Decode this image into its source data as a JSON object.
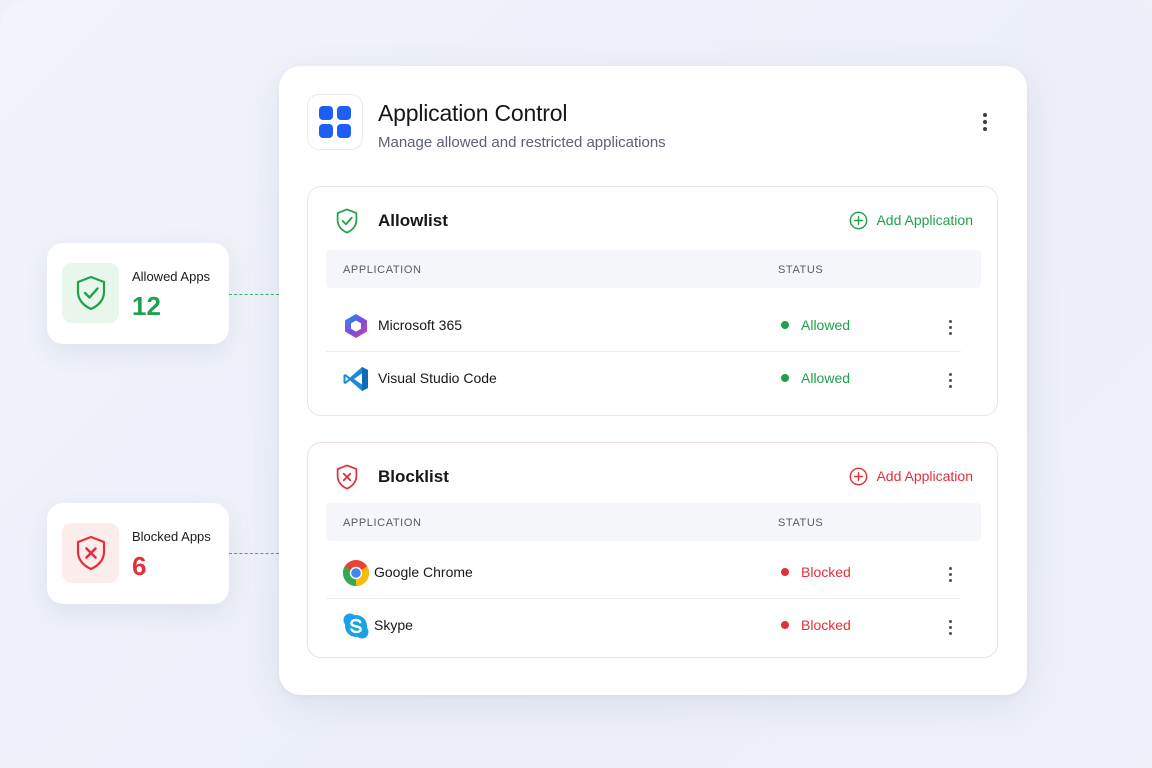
{
  "header": {
    "title": "Application Control",
    "subtitle": "Manage allowed and restricted applications",
    "icon": "apps-grid-icon",
    "accent": "#1f5ef5"
  },
  "stats": {
    "allowed": {
      "label": "Allowed Apps",
      "value": "12",
      "color": "#1fa14c"
    },
    "blocked": {
      "label": "Blocked Apps",
      "value": "6",
      "color": "#e0313a"
    }
  },
  "allowlist": {
    "title": "Allowlist",
    "add_label": "Add Application",
    "columns": [
      "APPLICATION",
      "STATUS"
    ],
    "rows": [
      {
        "name": "Microsoft 365",
        "status": "Allowed",
        "icon": "microsoft-365-icon"
      },
      {
        "name": "Visual Studio Code",
        "status": "Allowed",
        "icon": "vscode-icon"
      }
    ]
  },
  "blocklist": {
    "title": "Blocklist",
    "add_label": "Add Application",
    "columns": [
      "APPLICATION",
      "STATUS"
    ],
    "rows": [
      {
        "name": "Google Chrome",
        "status": "Blocked",
        "icon": "google-chrome-icon"
      },
      {
        "name": "Skype",
        "status": "Blocked",
        "icon": "skype-icon"
      }
    ]
  },
  "colors": {
    "allowed": "#1fa14c",
    "blocked": "#e0313a"
  }
}
